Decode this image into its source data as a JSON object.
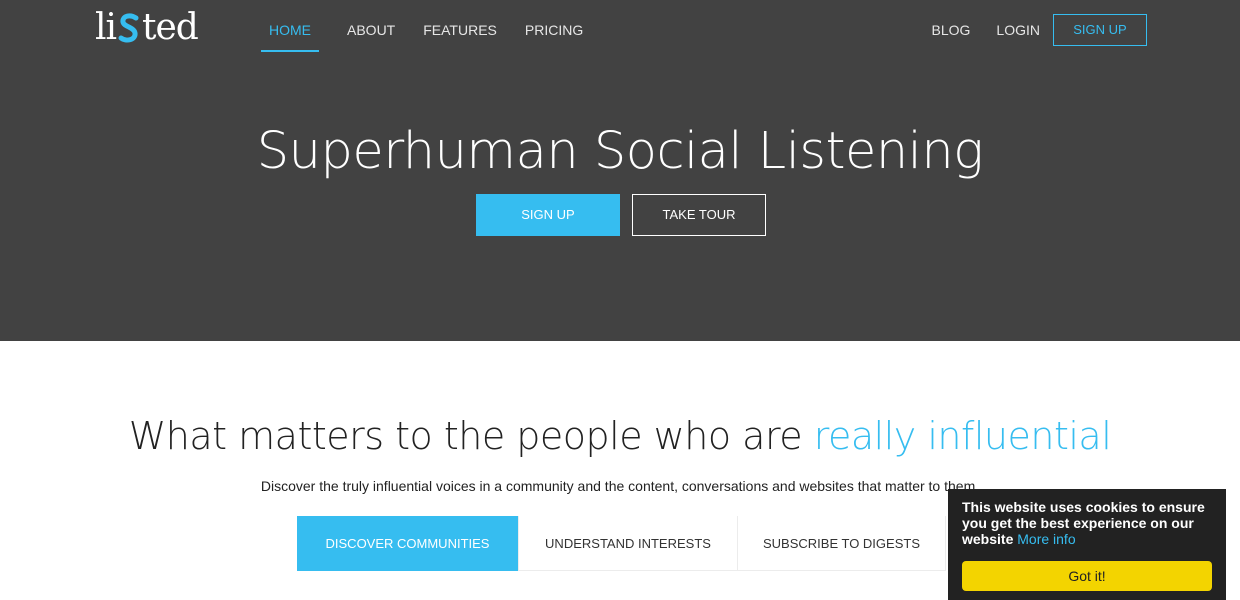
{
  "brand": {
    "logo_left": "li",
    "logo_right": "ted",
    "logo_mark": "ss"
  },
  "nav": {
    "left": [
      "HOME",
      "ABOUT",
      "FEATURES",
      "PRICING"
    ],
    "right": [
      "BLOG",
      "LOGIN"
    ],
    "signup": "SIGN UP"
  },
  "hero": {
    "title": "Superhuman Social Listening",
    "signup": "SIGN UP",
    "tour": "TAKE TOUR"
  },
  "section": {
    "title_main": "What matters to the people who are ",
    "title_accent": "really influential",
    "subtitle": "Discover the truly influential voices in a community and the content, conversations and websites that matter to them.",
    "tabs": [
      "DISCOVER COMMUNITIES",
      "UNDERSTAND INTERESTS",
      "SUBSCRIBE TO DIGESTS"
    ]
  },
  "cookie": {
    "message": "This website uses cookies to ensure you get the best experience on our website",
    "link": "More info",
    "button": "Got it!"
  },
  "colors": {
    "accent": "#36bdf0",
    "hero_bg": "#424242",
    "cookie_bg": "#222222",
    "cookie_btn": "#f3d400"
  }
}
